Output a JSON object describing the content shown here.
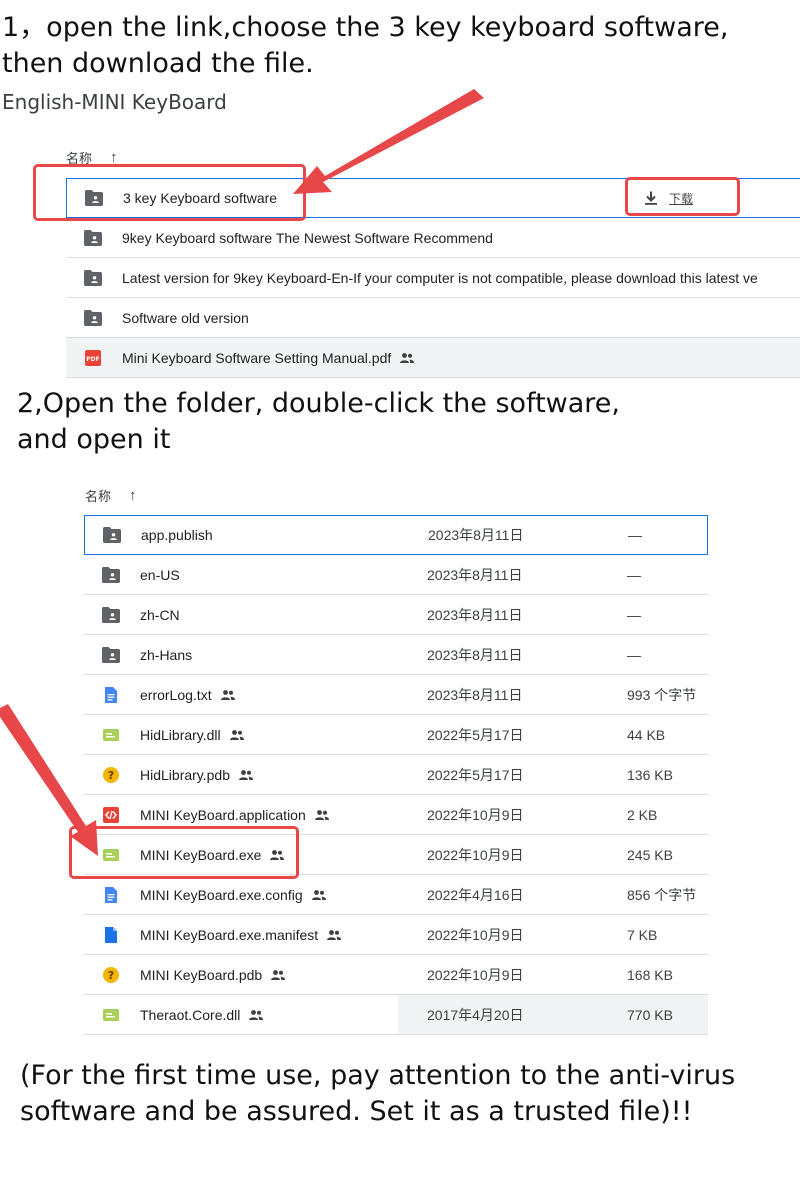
{
  "step1": {
    "title_line1": "1，open the link,choose the 3 key keyboard software,",
    "title_line2": "then download the file.",
    "folder_title": "English-MINI KeyBoard",
    "column_name": "名称",
    "download_label": "下载",
    "items": [
      {
        "name": "3 key Keyboard software",
        "icon": "shared-folder-icon",
        "shared": false
      },
      {
        "name": "9key Keyboard software The Newest Software Recommend",
        "icon": "shared-folder-icon",
        "shared": false
      },
      {
        "name": "Latest version for 9key Keyboard-En-If your computer is not compatible, please download this latest ve",
        "icon": "shared-folder-icon",
        "shared": false
      },
      {
        "name": "Software old version",
        "icon": "shared-folder-icon",
        "shared": false
      },
      {
        "name": "Mini Keyboard Software Setting Manual.pdf",
        "icon": "pdf-icon",
        "shared": true
      }
    ]
  },
  "step2": {
    "title_line1": "2,Open the folder, double-click the software,",
    "title_line2": "and open it",
    "column_name": "名称",
    "items": [
      {
        "name": "app.publish",
        "icon": "folder-icon",
        "shared": false,
        "modified": "2023年8月11日",
        "size": "—"
      },
      {
        "name": "en-US",
        "icon": "folder-icon",
        "shared": false,
        "modified": "2023年8月11日",
        "size": "—"
      },
      {
        "name": "zh-CN",
        "icon": "folder-icon",
        "shared": false,
        "modified": "2023年8月11日",
        "size": "—"
      },
      {
        "name": "zh-Hans",
        "icon": "folder-icon",
        "shared": false,
        "modified": "2023年8月11日",
        "size": "—"
      },
      {
        "name": "errorLog.txt",
        "icon": "doc-icon",
        "shared": true,
        "modified": "2023年8月11日",
        "size": "993 个字节"
      },
      {
        "name": "HidLibrary.dll",
        "icon": "binary-file-icon",
        "shared": true,
        "modified": "2022年5月17日",
        "size": "44 KB"
      },
      {
        "name": "HidLibrary.pdb",
        "icon": "unknown-file-icon",
        "shared": true,
        "modified": "2022年5月17日",
        "size": "136 KB"
      },
      {
        "name": "MINI KeyBoard.application",
        "icon": "code-file-icon",
        "shared": true,
        "modified": "2022年10月9日",
        "size": "2 KB"
      },
      {
        "name": "MINI KeyBoard.exe",
        "icon": "binary-file-icon",
        "shared": true,
        "modified": "2022年10月9日",
        "size": "245 KB"
      },
      {
        "name": "MINI KeyBoard.exe.config",
        "icon": "doc-icon",
        "shared": true,
        "modified": "2022年4月16日",
        "size": "856 个字节"
      },
      {
        "name": "MINI KeyBoard.exe.manifest",
        "icon": "blank-file-icon",
        "shared": true,
        "modified": "2022年10月9日",
        "size": "7 KB"
      },
      {
        "name": "MINI KeyBoard.pdb",
        "icon": "unknown-file-icon",
        "shared": true,
        "modified": "2022年10月9日",
        "size": "168 KB"
      },
      {
        "name": "Theraot.Core.dll",
        "icon": "binary-file-icon",
        "shared": true,
        "modified": "2017年4月20日",
        "size": "770 KB"
      }
    ]
  },
  "footer": {
    "line1": "(For the first time use, pay attention to the anti-virus",
    "line2": "software and be assured. Set it as a trusted file)!!"
  },
  "colors": {
    "annotation_red": "#e8474a",
    "folder_gray": "#5f6368",
    "selection_blue": "#1a73e8",
    "pdf_red": "#ea4335",
    "doc_blue": "#4285f4",
    "binary_green": "#a8d05a",
    "unknown_yellow": "#f4b400"
  }
}
